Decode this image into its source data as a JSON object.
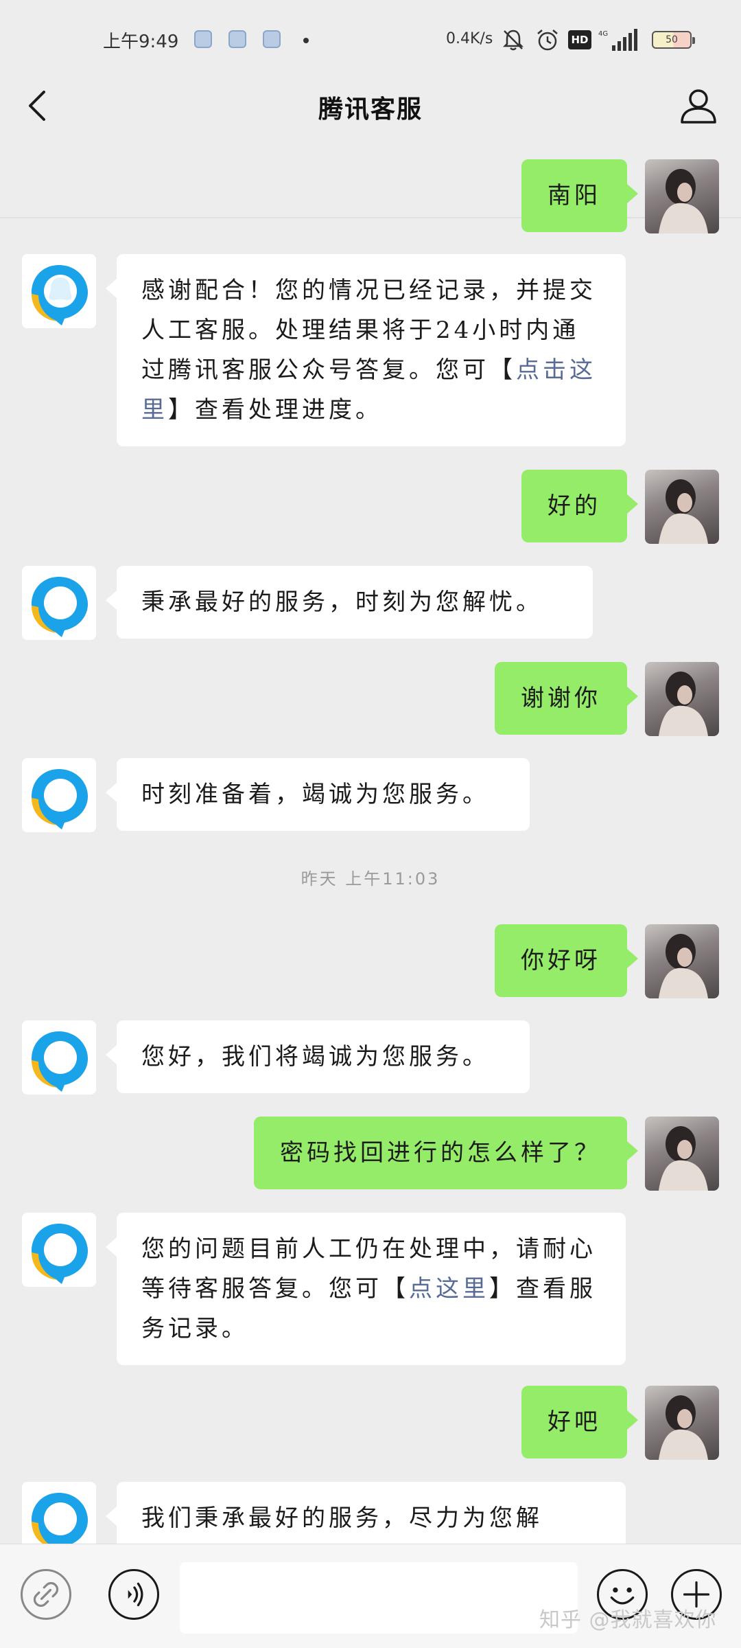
{
  "status_bar": {
    "time": "上午9:49",
    "net_speed": "0.4K/s",
    "hd_label": "HD",
    "battery_level": "50"
  },
  "header": {
    "title": "腾讯客服"
  },
  "messages": [
    {
      "from": "user",
      "text": "南阳"
    },
    {
      "from": "bot",
      "parts": [
        "感谢配合！您的情况已经记录，并提交人工客服。处理结果将于24小时内通过腾讯客服公众号答复。您可【",
        "点击这里",
        "】查看处理进度。"
      ]
    },
    {
      "from": "user",
      "text": "好的"
    },
    {
      "from": "bot",
      "text": "秉承最好的服务，时刻为您解忧。"
    },
    {
      "from": "user",
      "text": "谢谢你"
    },
    {
      "from": "bot",
      "text": "时刻准备着，竭诚为您服务。"
    },
    {
      "from": "user",
      "text": "你好呀"
    },
    {
      "from": "bot",
      "text": "您好，我们将竭诚为您服务。"
    },
    {
      "from": "user",
      "text": "密码找回进行的怎么样了？"
    },
    {
      "from": "bot",
      "parts": [
        "您的问题目前人工仍在处理中，请耐心等待客服答复。您可【",
        "点这里",
        "】查看服务记录。"
      ]
    },
    {
      "from": "user",
      "text": "好吧"
    },
    {
      "from": "bot",
      "text": "我们秉承最好的服务，尽力为您解"
    }
  ],
  "timestamp": "昨天 上午11:03",
  "input": {
    "placeholder": ""
  },
  "watermark": "知乎 @我就喜欢你",
  "colors": {
    "background": "#ededed",
    "user_bubble": "#95ec69",
    "bot_bubble": "#ffffff",
    "link": "#576b95"
  },
  "icons": {
    "back": "chevron-left-icon",
    "profile": "person-icon",
    "mini_program": "link-icon",
    "voice": "voice-icon",
    "emoji": "emoji-icon",
    "more": "plus-icon",
    "bot_avatar": "tencent-cs-logo-icon"
  }
}
